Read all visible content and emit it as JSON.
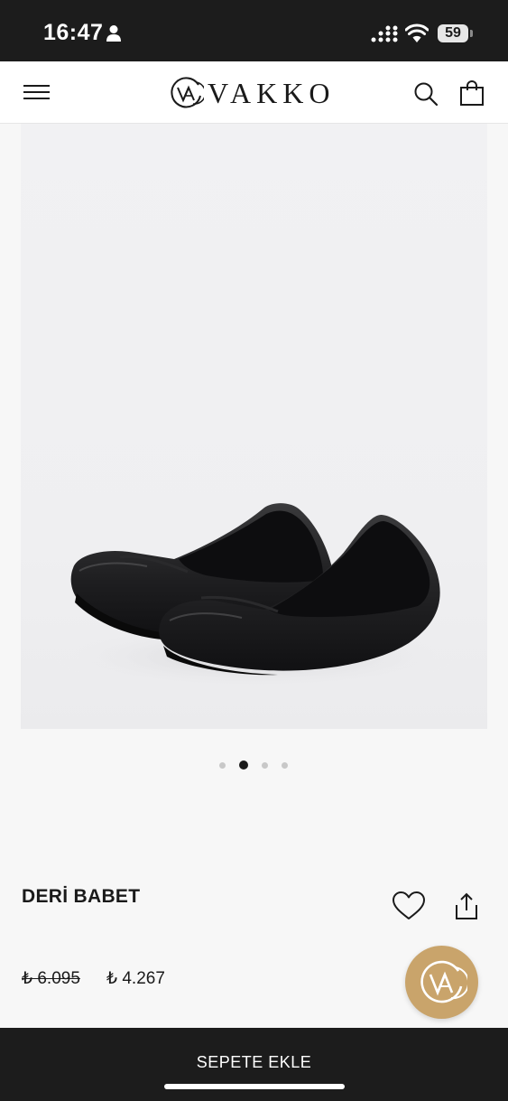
{
  "status_bar": {
    "time": "16:47",
    "battery": "59",
    "icons": [
      "person-icon",
      "cellular-signal-icon",
      "wifi-icon",
      "battery-icon"
    ]
  },
  "header": {
    "brand": "VAKKO",
    "icons": [
      "hamburger-menu-icon",
      "vakko-logo-mark",
      "search-icon",
      "shopping-bag-icon"
    ]
  },
  "product": {
    "title": "DERİ BABET",
    "price_old": "₺ 6.095",
    "price_new": "₺ 4.267",
    "image_index": 2,
    "image_count": 4
  },
  "actions": {
    "icons": [
      "heart-icon",
      "share-icon",
      "vakko-chat-badge"
    ],
    "add_to_cart": "SEPETE EKLE"
  },
  "colors": {
    "bar_dark": "#1c1c1c",
    "badge_gold": "#c9a46b",
    "image_bg": "#efeff1"
  }
}
